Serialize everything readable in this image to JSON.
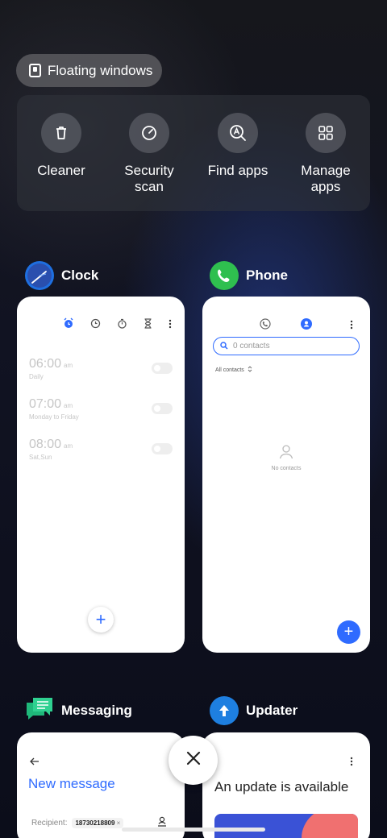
{
  "floating_windows": {
    "label": "Floating windows",
    "icon": "floating-window-icon"
  },
  "tools": [
    {
      "label": "Cleaner",
      "icon": "trash-icon"
    },
    {
      "label": "Security\nscan",
      "icon": "security-scan-icon"
    },
    {
      "label": "Find apps",
      "icon": "find-apps-icon"
    },
    {
      "label": "Manage\napps",
      "icon": "grid-icon"
    }
  ],
  "apps": {
    "clock": {
      "name": "Clock",
      "icon_color": "#1e6fe0",
      "alarms": [
        {
          "time": "06:00",
          "ampm": "am",
          "repeat": "Daily"
        },
        {
          "time": "07:00",
          "ampm": "am",
          "repeat": "Monday to Friday"
        },
        {
          "time": "08:00",
          "ampm": "am",
          "repeat": "Sat,Sun"
        }
      ],
      "add_label": "+"
    },
    "phone": {
      "name": "Phone",
      "icon_color": "#2fbf4f",
      "search_placeholder": "0 contacts",
      "filter_label": "All contacts",
      "empty_label": "No contacts",
      "add_label": "+"
    },
    "messaging": {
      "name": "Messaging",
      "icon_color": "#1fb87a",
      "title": "New message",
      "recipient_label": "Recipient:",
      "recipient_value": "18730218809",
      "chip_close": "×"
    },
    "updater": {
      "name": "Updater",
      "icon_color": "#1e7fe0",
      "title": "An update is available"
    }
  },
  "colors": {
    "accent": "#2f6bff",
    "background": "#0d0f1a"
  }
}
